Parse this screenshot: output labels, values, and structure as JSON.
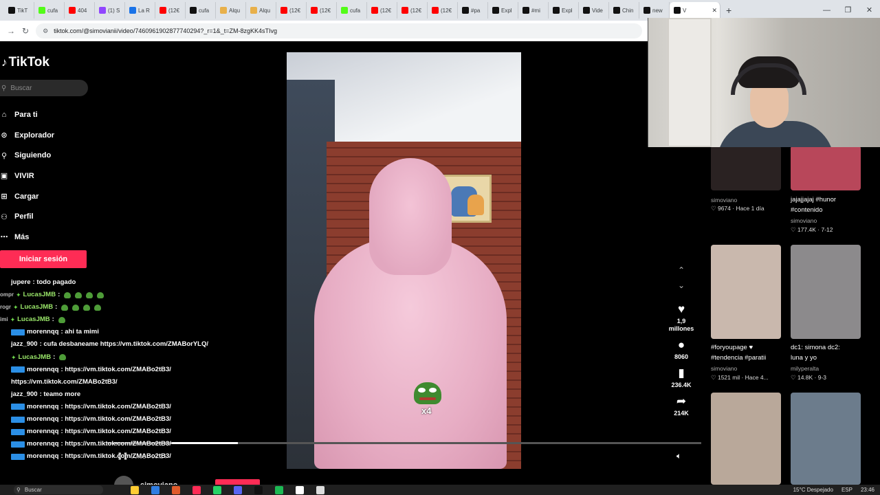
{
  "browser": {
    "tabs": [
      {
        "label": "TikT",
        "color": "#111111"
      },
      {
        "label": "cufa",
        "color": "#53fc18"
      },
      {
        "label": "404",
        "color": "#ff0000"
      },
      {
        "label": "(1) S",
        "color": "#9146ff"
      },
      {
        "label": "La R",
        "color": "#1a73e8"
      },
      {
        "label": "(12€",
        "color": "#ff0000"
      },
      {
        "label": "cufa",
        "color": "#111111"
      },
      {
        "label": "Alqu",
        "color": "#e8b04a"
      },
      {
        "label": "Alqu",
        "color": "#e8b04a"
      },
      {
        "label": "(12€",
        "color": "#ff0000"
      },
      {
        "label": "(12€",
        "color": "#ff0000"
      },
      {
        "label": "cufa",
        "color": "#53fc18"
      },
      {
        "label": "(12€",
        "color": "#ff0000"
      },
      {
        "label": "(12€",
        "color": "#ff0000"
      },
      {
        "label": "(12€",
        "color": "#ff0000"
      },
      {
        "label": "#pa",
        "color": "#111111"
      },
      {
        "label": "Expl",
        "color": "#111111"
      },
      {
        "label": "#mi",
        "color": "#111111"
      },
      {
        "label": "Expl",
        "color": "#111111"
      },
      {
        "label": "Vide",
        "color": "#111111"
      },
      {
        "label": "Chin",
        "color": "#111111"
      },
      {
        "label": "new",
        "color": "#111111"
      }
    ],
    "active_tab": {
      "label": "V"
    },
    "new_tab_symbol": "+",
    "window_controls": [
      "—",
      "❐",
      "✕"
    ],
    "url": "tiktok.com/@simovianii/video/7460961902877740294?_r=1&_t=ZM-8zgKK4sTIvg"
  },
  "tiktok": {
    "logo": "TikTok",
    "search_placeholder": "Buscar",
    "menu": [
      {
        "label": "Para ti",
        "icon": "⌂"
      },
      {
        "label": "Explorador",
        "icon": "⊙"
      },
      {
        "label": "Siguiendo",
        "icon": "⚲"
      },
      {
        "label": "VIVIR",
        "icon": "▣"
      },
      {
        "label": "Cargar",
        "icon": "⊞"
      },
      {
        "label": "Perfil",
        "icon": "⚇"
      },
      {
        "label": "Más",
        "icon": "⋯"
      }
    ],
    "login_label": "Iniciar sesión",
    "likes": "1,9\nmillones",
    "comments": "8060",
    "saves": "236.4K",
    "shares": "214K",
    "video_time": "00:03 / 00:14",
    "progress_fraction": 0.22,
    "author": "simoviano",
    "emote_text": "x4"
  },
  "chat": [
    {
      "pre": "",
      "user": "jupere",
      "text": ": todo pagado",
      "style": "plain"
    },
    {
      "pre": "ompr",
      "user": "LucasJMB",
      "text": ":",
      "style": "green-emotes",
      "emotes": 4
    },
    {
      "pre": "rogr",
      "user": "LucasJMB",
      "text": ":",
      "style": "green-emotes",
      "emotes": 4
    },
    {
      "pre": "imi",
      "user": "LucasJMB",
      "text": ":",
      "style": "green-emotes",
      "emotes": 1
    },
    {
      "pre": "",
      "user": "morennqq",
      "text": ": ahi ta mimi",
      "style": "badge"
    },
    {
      "pre": "",
      "user": "jazz_900",
      "text": ": cufa desbaneame https://vm.tiktok.com/ZMABorYLQ/",
      "style": "plain"
    },
    {
      "pre": "",
      "user": "LucasJMB",
      "text": ":",
      "style": "star",
      "emotes": 1
    },
    {
      "pre": "",
      "user": "morennqq",
      "text": ": https://vm.tiktok.com/ZMABo2tB3/",
      "style": "badge"
    },
    {
      "pre": "",
      "user": "",
      "text": "https://vm.tiktok.com/ZMABo2tB3/",
      "style": "cont"
    },
    {
      "pre": "",
      "user": "jazz_900",
      "text": ": teamo more",
      "style": "plain"
    },
    {
      "pre": "",
      "user": "morennqq",
      "text": ": https://vm.tiktok.com/ZMABo2tB3/",
      "style": "badge"
    },
    {
      "pre": "",
      "user": "morennqq",
      "text": ": https://vm.tiktok.com/ZMABo2tB3/",
      "style": "badge"
    },
    {
      "pre": "",
      "user": "morennqq",
      "text": ": https://vm.tiktok.com/ZMABo2tB3/",
      "style": "badge"
    },
    {
      "pre": "",
      "user": "morennqq",
      "text": ": https://vm.tiktok.com/ZMABo2tB3/",
      "style": "badge"
    },
    {
      "pre": "",
      "user": "morennqq",
      "text": ": https://vm.tiktok.com/ZMABo2tB3/",
      "style": "badge"
    }
  ],
  "grid": {
    "row1": [
      {
        "title": "",
        "user": "simoviano",
        "meta": "♡ 9674 · Hace 1 día",
        "bg": "#2a2222"
      },
      {
        "title": "jajajjajaj #hunor\n#contenido",
        "user": "simoviano",
        "meta": "♡ 177.4K · 7-12",
        "bg": "#b8475a"
      }
    ],
    "row2": [
      {
        "title": "#foryoupage ♥\n#tendencia #paratii",
        "user": "simoviano",
        "meta": "♡ 1521 mil · Hace 4...",
        "bg": "#c9b8ad"
      },
      {
        "title": "dc1: simona dc2:\nluna y yo",
        "user": "milyperalta",
        "meta": "♡ 14.8K · 9-3",
        "bg": "#8c8a8c"
      }
    ],
    "row3": [
      {
        "bg": "#b9a89a"
      },
      {
        "bg": "#6c7c8c"
      }
    ]
  },
  "taskbar": {
    "search_placeholder": "Buscar",
    "weather": "15°C Despejado",
    "lang": "ESP",
    "clock": "23:46",
    "apps": [
      "#ffcc33",
      "#2f7de1",
      "#e05a2a",
      "#fe2c55",
      "#25d366",
      "#5865f2",
      "#111111",
      "#1db954",
      "#ffffff",
      "#dddddd"
    ]
  }
}
